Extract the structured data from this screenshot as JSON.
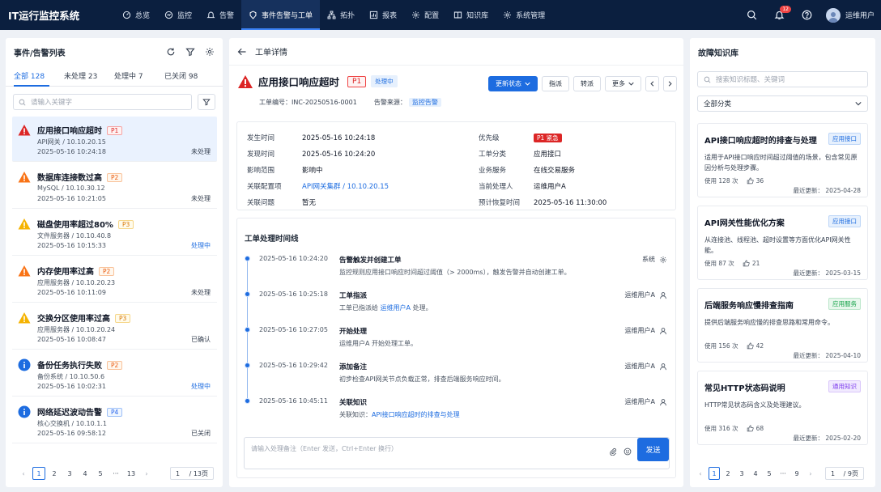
{
  "app": {
    "title": "IT运行监控系统"
  },
  "nav": {
    "items": [
      {
        "label": "总览",
        "icon": "dashboard-icon"
      },
      {
        "label": "监控",
        "icon": "monitor-icon"
      },
      {
        "label": "告警",
        "icon": "bell-icon"
      },
      {
        "label": "事件告警与工单",
        "icon": "ticket-icon",
        "active": true
      },
      {
        "label": "拓扑",
        "icon": "topology-icon"
      },
      {
        "label": "报表",
        "icon": "report-icon"
      },
      {
        "label": "配置",
        "icon": "settings-icon"
      },
      {
        "label": "知识库",
        "icon": "book-icon"
      },
      {
        "label": "系统管理",
        "icon": "gear-icon"
      }
    ],
    "notification_count": "12",
    "user_name": "运维用户"
  },
  "left_panel": {
    "title": "事件/告警列表",
    "tabs": [
      {
        "label": "全部 128",
        "active": true
      },
      {
        "label": "未处理 23"
      },
      {
        "label": "处理中 7"
      },
      {
        "label": "已关闭 98"
      }
    ],
    "search_placeholder": "请输入关键字",
    "alerts": [
      {
        "title": "应用接口响应超时",
        "priority": "P1",
        "level": "error",
        "source": "API网关  /  10.10.20.15",
        "time": "2025-05-16 10:24:18",
        "status": "未处理",
        "selected": true
      },
      {
        "title": "数据库连接数过高",
        "priority": "P2",
        "level": "high",
        "source": "MySQL  /  10.10.30.12",
        "time": "2025-05-16 10:21:05",
        "status": "未处理"
      },
      {
        "title": "磁盘使用率超过80%",
        "priority": "P3",
        "level": "warn",
        "source": "文件服务器  /  10.10.40.8",
        "time": "2025-05-16 10:15:33",
        "status": "处理中",
        "status_blue": true
      },
      {
        "title": "内存使用率过高",
        "priority": "P2",
        "level": "high",
        "source": "应用服务器  /  10.10.20.23",
        "time": "2025-05-16 10:11:09",
        "status": "未处理"
      },
      {
        "title": "交换分区使用率过高",
        "priority": "P3",
        "level": "warn",
        "source": "应用服务器  /  10.10.20.24",
        "time": "2025-05-16 10:08:47",
        "status": "已确认"
      },
      {
        "title": "备份任务执行失败",
        "priority": "P2",
        "level": "info",
        "source": "备份系统  /  10.10.50.6",
        "time": "2025-05-16 10:02:31",
        "status": "处理中",
        "status_blue": true
      },
      {
        "title": "网络延迟波动告警",
        "priority": "P4",
        "level": "info",
        "source": "核心交换机  /  10.10.1.1",
        "time": "2025-05-16 09:58:12",
        "status": "已关闭"
      }
    ],
    "pager": {
      "pages": [
        "1",
        "2",
        "3",
        "4",
        "5",
        "···",
        "13"
      ],
      "current": "1",
      "jump": "1",
      "total": " / 13页"
    }
  },
  "detail": {
    "header_title": "工单详情",
    "title": "应用接口响应超时",
    "priority": "P1",
    "status": "处理中",
    "ticket_no_label": "工单编号：",
    "ticket_no": "INC-20250516-0001",
    "source_label": "告警来源：",
    "source": "监控告警",
    "actions": {
      "update_status": "更新状态",
      "assign": "指派",
      "transfer": "转派",
      "more": "更多"
    },
    "info": {
      "occur_label": "发生时间",
      "occur": "2025-05-16 10:24:18",
      "detect_label": "发现时间",
      "detect": "2025-05-16 10:24:20",
      "scope_label": "影响范围",
      "scope": "影响中",
      "ci_label": "关联配置项",
      "ci": "API网关集群 / 10.10.20.15",
      "issue_label": "关联问题",
      "issue": "暂无",
      "priority_label": "优先级",
      "priority_val": "P1 紧急",
      "category_label": "工单分类",
      "category": "应用接口",
      "service_label": "业务服务",
      "service": "在线交易服务",
      "handler_label": "当前处理人",
      "handler": "运维用户A",
      "eta_label": "预计恢复时间",
      "eta": "2025-05-16 11:30:00"
    },
    "timeline_title": "工单处理时间线",
    "timeline": [
      {
        "time": "2025-05-16 10:24:20",
        "event": "告警触发并创建工单",
        "desc": "监控规则应用接口响应时间超过阈值（> 2000ms），触发告警并自动创建工单。",
        "who": "系统",
        "who_icon": "gear-icon"
      },
      {
        "time": "2025-05-16 10:25:18",
        "event": "工单指派",
        "desc_prefix": "工单已指派给 ",
        "desc_link": "运维用户A",
        "desc_suffix": " 处理。",
        "who": "运维用户A",
        "who_icon": "user-icon"
      },
      {
        "time": "2025-05-16 10:27:05",
        "event": "开始处理",
        "desc": "运维用户A 开始处理工单。",
        "who": "运维用户A",
        "who_icon": "user-icon"
      },
      {
        "time": "2025-05-16 10:29:42",
        "event": "添加备注",
        "desc": "初步检查API网关节点负载正常，排查后端服务响应时间。",
        "who": "运维用户A",
        "who_icon": "user-icon"
      },
      {
        "time": "2025-05-16 10:45:11",
        "event": "关联知识",
        "desc_prefix": "关联知识：",
        "desc_link": "API接口响应超时的排查与处理",
        "desc_suffix": "",
        "who": "运维用户A",
        "who_icon": "user-icon"
      }
    ],
    "input_placeholder": "请输入处理备注（Enter 发送，Ctrl+Enter 换行）",
    "send": "发送"
  },
  "kb": {
    "title": "故障知识库",
    "search_placeholder": "搜索知识标题、关键词",
    "category": "全部分类",
    "items": [
      {
        "title": "API接口响应超时的排查与处理",
        "tag": "应用接口",
        "tag_color": "#1d6ce0",
        "tag_bg": "#e6f0fd",
        "desc": "适用于API接口响应时间超过阈值的场景，包含常见原因分析与处理步骤。",
        "views": "使用  128  次",
        "likes": "36",
        "updated": "最近更新：  2025-04-28"
      },
      {
        "title": "API网关性能优化方案",
        "tag": "应用接口",
        "tag_color": "#1d6ce0",
        "tag_bg": "#e6f0fd",
        "desc": "从连接池、线程池、超时设置等方面优化API网关性能。",
        "views": "使用  87  次",
        "likes": "21",
        "updated": "最近更新：  2025-03-15"
      },
      {
        "title": "后端服务响应慢排查指南",
        "tag": "应用服务",
        "tag_color": "#16a34a",
        "tag_bg": "#e7f7ec",
        "desc": "提供后端服务响应慢的排查思路和常用命令。",
        "views": "使用  156  次",
        "likes": "42",
        "updated": "最近更新：  2025-04-10"
      },
      {
        "title": "常见HTTP状态码说明",
        "tag": "通用知识",
        "tag_color": "#7c3aed",
        "tag_bg": "#f1eafe",
        "desc": "HTTP常见状态码含义及处理建议。",
        "views": "使用  316  次",
        "likes": "68",
        "updated": "最近更新：  2025-02-20"
      }
    ],
    "pager": {
      "pages": [
        "1",
        "2",
        "3",
        "4",
        "5",
        "···",
        "9"
      ],
      "current": "1",
      "jump": "1",
      "total": " / 9页"
    }
  }
}
